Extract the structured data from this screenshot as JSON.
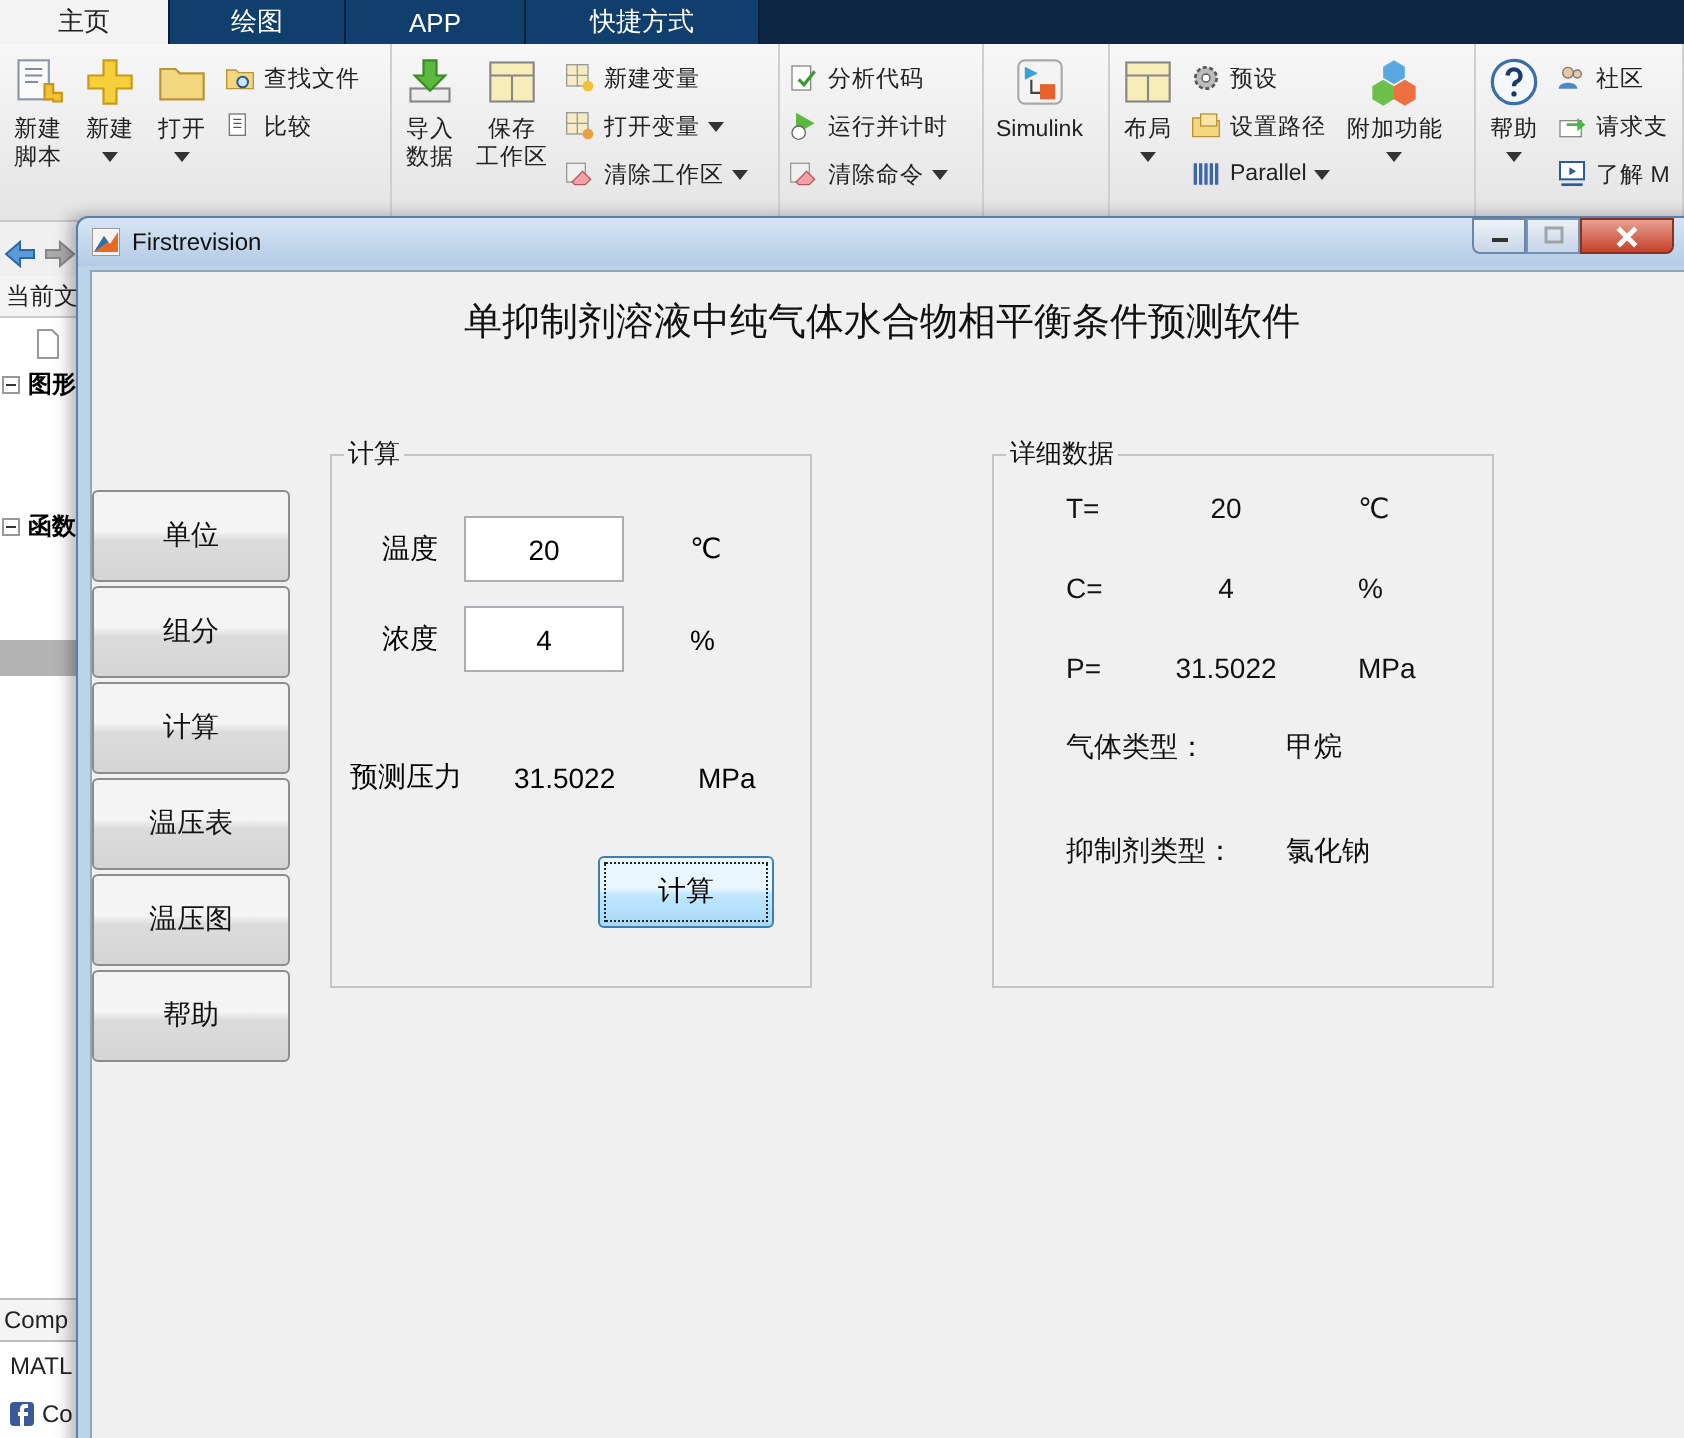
{
  "ribbon_tabs": [
    {
      "label": "主页",
      "selected": true
    },
    {
      "label": "绘图",
      "selected": false
    },
    {
      "label": "APP",
      "selected": false
    },
    {
      "label": "快捷方式",
      "selected": false
    }
  ],
  "ribbon_groups": [
    {
      "large": [
        {
          "lines": [
            "新建",
            "脚本"
          ],
          "dropdown": false
        },
        {
          "lines": [
            "新建"
          ],
          "dropdown": true
        },
        {
          "lines": [
            "打开"
          ],
          "dropdown": true
        }
      ],
      "small": [
        {
          "label": "查找文件",
          "dropdown": false
        },
        {
          "label": "比较",
          "dropdown": false
        }
      ]
    },
    {
      "large": [
        {
          "lines": [
            "导入",
            "数据"
          ],
          "dropdown": false
        },
        {
          "lines": [
            "保存",
            "工作区"
          ],
          "dropdown": false
        }
      ],
      "small": [
        {
          "label": "新建变量",
          "dropdown": false
        },
        {
          "label": "打开变量",
          "dropdown": true
        },
        {
          "label": "清除工作区",
          "dropdown": true
        }
      ]
    },
    {
      "small": [
        {
          "label": "分析代码",
          "dropdown": false
        },
        {
          "label": "运行并计时",
          "dropdown": false
        },
        {
          "label": "清除命令",
          "dropdown": true
        }
      ]
    },
    {
      "large": [
        {
          "lines": [
            "Simulink"
          ],
          "dropdown": false
        }
      ]
    },
    {
      "large": [
        {
          "lines": [
            "布局"
          ],
          "dropdown": true
        }
      ],
      "small": [
        {
          "label": "预设",
          "dropdown": false
        },
        {
          "label": "设置路径",
          "dropdown": false
        },
        {
          "label": "Parallel",
          "dropdown": true
        }
      ],
      "large_after": [
        {
          "lines": [
            "附加功能"
          ],
          "dropdown": true
        }
      ]
    },
    {
      "large": [
        {
          "lines": [
            "帮助"
          ],
          "dropdown": true
        }
      ],
      "small": [
        {
          "label": "社区",
          "dropdown": false
        },
        {
          "label": "请求支",
          "dropdown": false
        },
        {
          "label": "了解 M",
          "dropdown": false
        }
      ]
    }
  ],
  "left_panel": {
    "path_label": "当前文",
    "tree": [
      {
        "label": "图形",
        "expanded": true
      },
      {
        "label": "函数",
        "expanded": true
      }
    ],
    "bottom_tab": "Comp",
    "bottom_items": [
      "MATL",
      "Co"
    ]
  },
  "dialog": {
    "title": "Firstrevision",
    "heading": "单抑制剂溶液中纯气体水合物相平衡条件预测软件",
    "nav_buttons": [
      "单位",
      "组分",
      "计算",
      "温压表",
      "温压图",
      "帮助"
    ],
    "calc_panel": {
      "title": "计算",
      "fields": [
        {
          "label": "温度",
          "value": "20",
          "unit": "℃"
        },
        {
          "label": "浓度",
          "value": "4",
          "unit": "%"
        }
      ],
      "result": {
        "label": "预测压力",
        "value": "31.5022",
        "unit": "MPa"
      },
      "button": {
        "label": "计算",
        "default": true
      }
    },
    "detail_panel": {
      "title": "详细数据",
      "rows": [
        {
          "label": "T=",
          "value": "20",
          "unit": "℃"
        },
        {
          "label": "C=",
          "value": "4",
          "unit": "%"
        },
        {
          "label": "P=",
          "value": "31.5022",
          "unit": "MPa"
        },
        {
          "label": "气体类型：",
          "value": "甲烷"
        },
        {
          "label": "抑制剂类型：",
          "value": "氯化钠"
        }
      ]
    }
  }
}
